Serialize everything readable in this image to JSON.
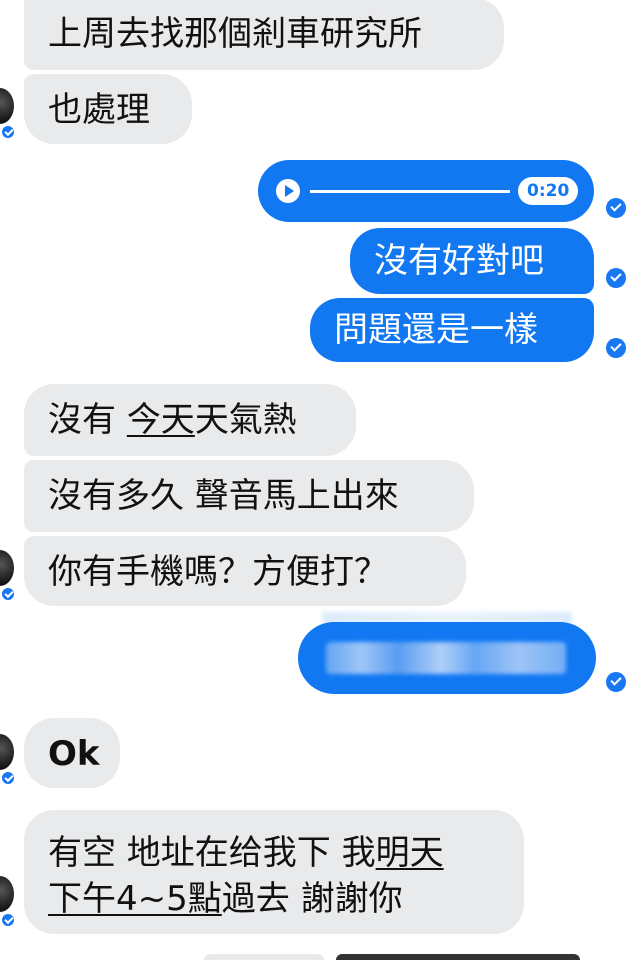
{
  "messages": {
    "m1": "上周去找那個剎車研究所",
    "m2": "也處理",
    "voice_duration": "0:20",
    "m3": "沒有好對吧",
    "m4": "問題還是一樣",
    "m5_a": "沒有 ",
    "m5_b": "今天",
    "m5_c": "天氣熱",
    "m6": "沒有多久 聲音馬上出來",
    "m7": "你有手機嗎？方便打？",
    "m8": "Ok",
    "m9_line1_a": "有空 地址在给我下 我",
    "m9_line1_b": "明天",
    "m9_line2_a": "下午4~5點",
    "m9_line2_b": "過去 謝謝你"
  },
  "icons": {
    "seen": "seen-check-icon",
    "play": "play-icon",
    "avatar": "contact-avatar",
    "avatar_badge": "messenger-badge-icon"
  },
  "colors": {
    "outgoing": "#1178f2",
    "incoming": "#e9eaec",
    "seen": "#1778f2"
  }
}
